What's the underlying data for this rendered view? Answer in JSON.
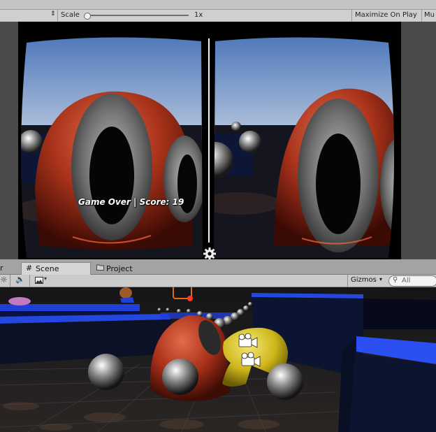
{
  "game_toolbar": {
    "scale_label": "Scale",
    "scale_value": "1x",
    "scale_fraction": 0.0,
    "maximize_on_play_label": "Maximize On Play",
    "mute_audio_label": "Mu"
  },
  "game": {
    "hud_text": "Game Over | Score: 19"
  },
  "tabs": {
    "partial_left_label": "r",
    "scene_label": "Scene",
    "project_label": "Project",
    "active": "Scene"
  },
  "scene_toolbar": {
    "gizmos_label": "Gizmos",
    "search_placeholder": "All"
  },
  "colors": {
    "editor_bg": "#a3a3a3",
    "toolbar_bg": "#cbcbcb",
    "maze_blue": "#1f3fd6",
    "enemy_red": "#b83218",
    "player_yellow": "#d8c21a"
  }
}
